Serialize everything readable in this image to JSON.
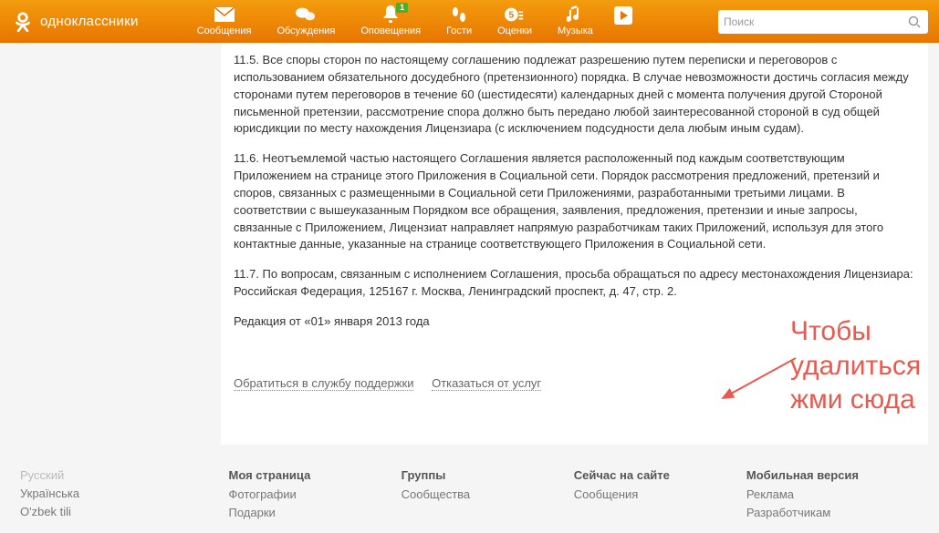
{
  "header": {
    "brand": "одноклассники",
    "nav": [
      {
        "key": "messages",
        "label": "Сообщения"
      },
      {
        "key": "discussions",
        "label": "Обсуждения"
      },
      {
        "key": "notifications",
        "label": "Оповещения",
        "badge": "1"
      },
      {
        "key": "guests",
        "label": "Гости"
      },
      {
        "key": "marks",
        "label": "Оценки"
      },
      {
        "key": "music",
        "label": "Музыка"
      }
    ],
    "play_label": "",
    "search_placeholder": "Поиск"
  },
  "content": {
    "p_11_5": "11.5. Все споры сторон по настоящему соглашению подлежат разрешению путем переписки и переговоров с использованием обязательного досудебного (претензионного) порядка. В случае невозможности достичь согласия между сторонами путем переговоров в течение 60 (шестидесяти) календарных дней с момента получения другой Стороной письменной претензии, рассмотрение спора должно быть передано любой заинтересованной стороной в суд общей юрисдикции по месту нахождения Лицензиара (с исключением подсудности дела любым иным судам).",
    "p_11_6": "11.6. Неотъемлемой частью настоящего Соглашения является расположенный под каждым соответствующим Приложением на странице этого Приложения в Социальной сети. Порядок рассмотрения предложений, претензий и споров, связанных с размещенными в Социальной сети Приложениями, разработанными третьими лицами. В соответствии с вышеуказанным Порядком все обращения, заявления, предложения, претензии и иные запросы, связанные с Приложением, Лицензиат направляет напрямую разработчикам таких Приложений, используя для этого контактные данные, указанные на странице соответствующего Приложения в Социальной сети.",
    "p_11_7": "11.7. По вопросам, связанным с исполнением Соглашения, просьба обращаться по адресу местонахождения Лицензиара: Российская Федерация, 125167 г. Москва, Ленинградский проспект, д. 47, стр. 2.",
    "revision": "Редакция от «01» января 2013 года",
    "support_link": "Обратиться в службу поддержки",
    "refuse_link": "Отказаться от услуг"
  },
  "annotation": {
    "text": "Чтобы удалиться жми сюда"
  },
  "footer": {
    "langs": [
      "Русский",
      "Українська",
      "O'zbek tili"
    ],
    "cols": [
      {
        "title": "Моя страница",
        "links": [
          "Фотографии",
          "Подарки"
        ]
      },
      {
        "title": "Группы",
        "links": [
          "Сообщества"
        ]
      },
      {
        "title": "Сейчас на сайте",
        "links": [
          "Сообщения"
        ]
      },
      {
        "title": "Мобильная версия",
        "links": [
          "Реклама",
          "Разработчикам"
        ]
      }
    ]
  }
}
